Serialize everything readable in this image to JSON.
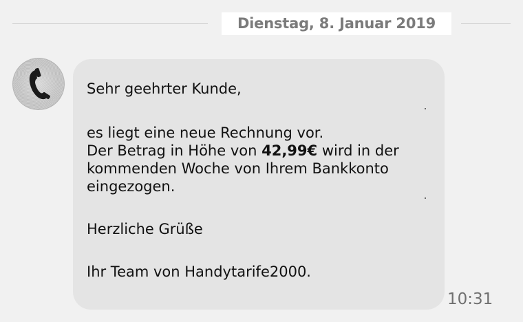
{
  "date_header": {
    "label": "Dienstag, 8. Januar 2019"
  },
  "sender": {
    "avatar_icon": "telephone-handset-icon"
  },
  "message": {
    "greeting": "Sehr geehrter Kunde,",
    "line1": "es liegt eine neue Rechnung vor.",
    "line2_prefix": "Der Betrag in Höhe von ",
    "amount": "42,99€",
    "line2_suffix": " wird in der",
    "line3": "kommenden Woche von Ihrem Bankkonto",
    "line4": "eingezogen.",
    "closing": "Herzliche Grüße",
    "signature": "Ihr Team von Handytarife2000.",
    "timestamp": "10:31"
  },
  "colors": {
    "background": "#f1f1f1",
    "bubble": "#e4e4e4",
    "date_text": "#7b7b7b",
    "message_text": "#111111",
    "timestamp_text": "#6f6f6f"
  }
}
